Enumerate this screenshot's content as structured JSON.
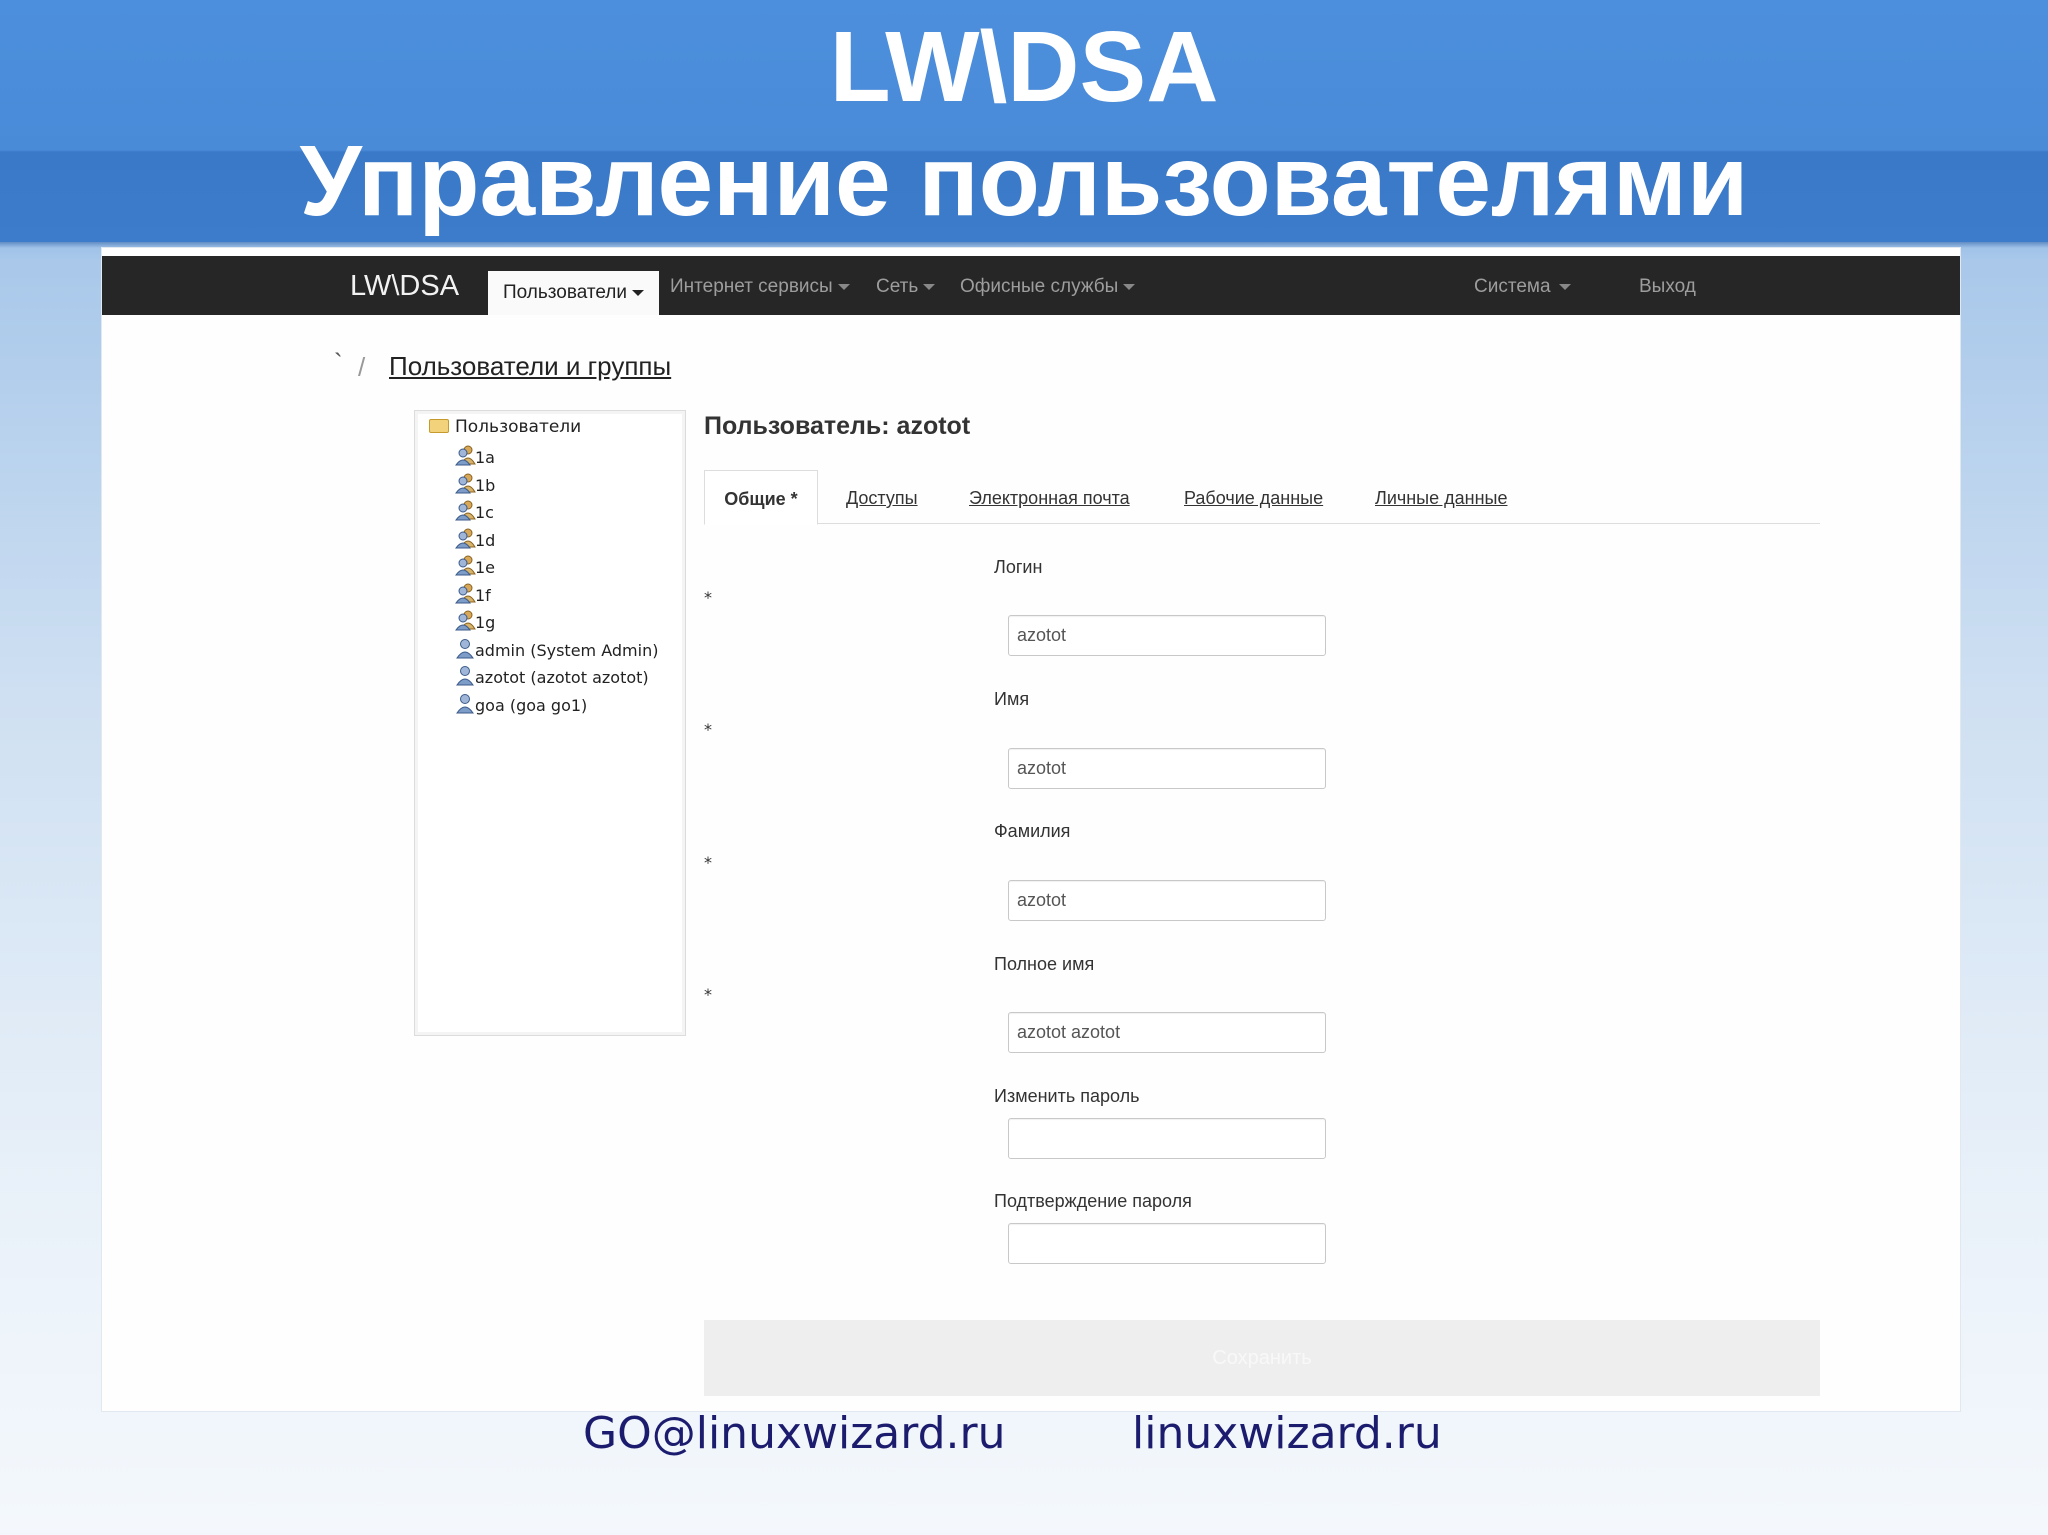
{
  "slide": {
    "title_line1": "LW\\DSA",
    "title_line2": "Управление пользователями",
    "footer_email": "GO@linuxwizard.ru",
    "footer_site": "linuxwizard.ru"
  },
  "navbar": {
    "brand": "LW\\DSA",
    "items": [
      {
        "label": "Пользователи",
        "active": true
      },
      {
        "label": "Интернет сервисы"
      },
      {
        "label": "Сеть"
      },
      {
        "label": "Офисные службы"
      }
    ],
    "system_label": "Система",
    "logout_label": "Выход"
  },
  "breadcrumb": {
    "home": "`",
    "separator": "/",
    "link": "Пользователи и группы"
  },
  "tree": {
    "root": "Пользователи",
    "items": [
      {
        "label": "1a",
        "icon": "group-icon"
      },
      {
        "label": "1b",
        "icon": "group-icon"
      },
      {
        "label": "1c",
        "icon": "group-icon"
      },
      {
        "label": "1d",
        "icon": "group-icon"
      },
      {
        "label": "1e",
        "icon": "group-icon"
      },
      {
        "label": "1f",
        "icon": "group-icon"
      },
      {
        "label": "1g",
        "icon": "group-icon"
      },
      {
        "label": "admin (System Admin)",
        "icon": "user-icon"
      },
      {
        "label": "azotot (azotot azotot)",
        "icon": "user-icon"
      },
      {
        "label": "goa (goa go1)",
        "icon": "user-icon"
      }
    ]
  },
  "main": {
    "title": "Пользователь: azotot",
    "tabs": [
      {
        "label": "Общие *",
        "active": true
      },
      {
        "label": "Доступы"
      },
      {
        "label": "Электронная почта"
      },
      {
        "label": "Рабочие данные"
      },
      {
        "label": "Личные данные"
      }
    ],
    "required_mark": "*",
    "fields": [
      {
        "label": "Логин",
        "value": "azotot",
        "required": true
      },
      {
        "label": "Имя",
        "value": "azotot",
        "required": true
      },
      {
        "label": "Фамилия",
        "value": "azotot",
        "required": true
      },
      {
        "label": "Полное имя",
        "value": "azotot azotot",
        "required": true
      },
      {
        "label": "Изменить пароль",
        "value": ""
      },
      {
        "label": "Подтверждение пароля",
        "value": ""
      }
    ],
    "save_label": "Сохранить"
  }
}
